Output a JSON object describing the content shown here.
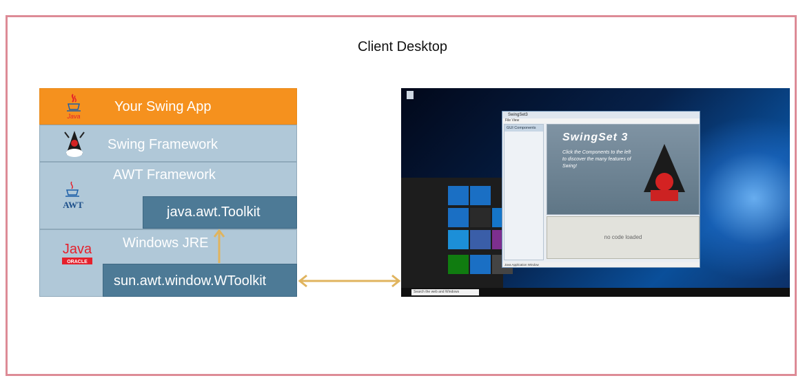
{
  "title": "Client Desktop",
  "stack": {
    "app": "Your Swing App",
    "swing": "Swing Framework",
    "awt": "AWT Framework",
    "awt_toolkit": "java.awt.Toolkit",
    "jre": "Windows JRE",
    "wtoolkit": "sun.awt.window.WToolkit"
  },
  "logos": {
    "java_small": "Java",
    "awt_logo": "AWT",
    "java_oracle_top": "Java",
    "java_oracle_bottom": "ORACLE"
  },
  "screenshot": {
    "window_title": "SwingSet3",
    "menu": "File   View",
    "gui_components": "GUI Components",
    "banner_title": "SwingSet 3",
    "banner_text": "Click the Components to the left to discover the many features of Swing!",
    "code_panel": "no code loaded",
    "status": "Java Application Window",
    "search_placeholder": "Search the web and Windows"
  },
  "colors": {
    "frame": "#dd8b96",
    "app_layer": "#f5911e",
    "layer": "#b0c8d8",
    "box": "#4d7a96",
    "arrow": "#e0b45e"
  },
  "icons": [
    "java-cup-icon",
    "duke-icon",
    "awt-logo-icon",
    "java-oracle-logo-icon",
    "double-arrow-icon",
    "up-arrow-icon"
  ]
}
